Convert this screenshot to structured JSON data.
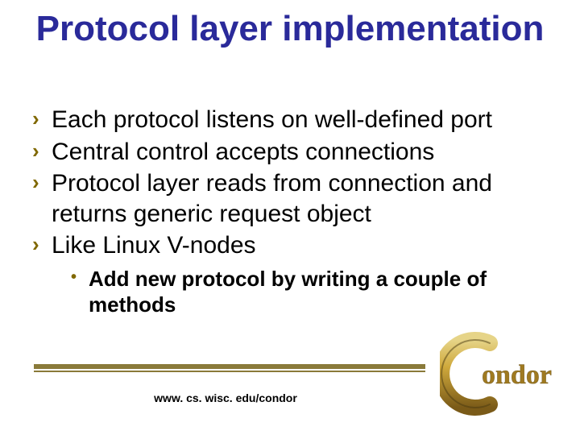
{
  "title": "Protocol layer implementation",
  "bullets": [
    "Each protocol listens on well-defined port",
    "Central control accepts connections",
    "Protocol layer reads from connection and returns generic request object",
    "Like Linux V-nodes"
  ],
  "sub_bullet": "Add new protocol by writing a couple of methods",
  "url": "www. cs. wisc. edu/condor",
  "logo_text": "ondor",
  "colors": {
    "title": "#2a2a9a",
    "bullet_arrow": "#806800",
    "divider": "#8a7a3a"
  }
}
